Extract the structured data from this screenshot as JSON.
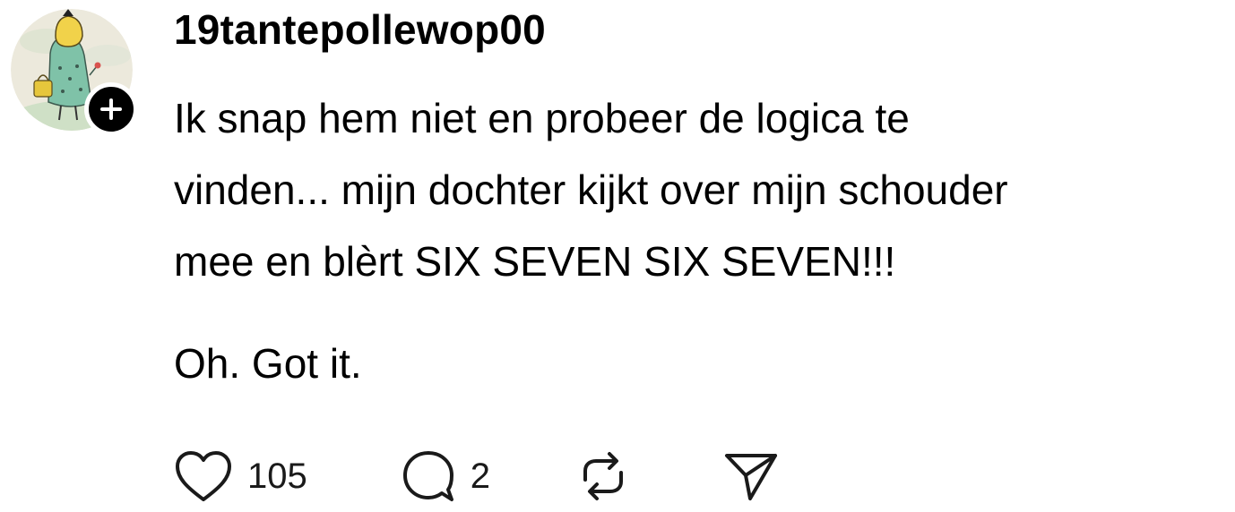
{
  "post": {
    "author": {
      "username": "19tantepollewop00",
      "avatar_icon": "avatar-illustration-icon",
      "follow_icon": "plus-icon"
    },
    "body": {
      "line1": "Ik snap hem niet en probeer de logica te",
      "line2": "vinden... mijn dochter kijkt over mijn schouder",
      "line3": "mee en blèrt SIX SEVEN SIX SEVEN!!!",
      "line4": "Oh. Got it."
    },
    "actions": {
      "like": {
        "icon": "heart-icon",
        "count": "105"
      },
      "reply": {
        "icon": "speech-bubble-icon",
        "count": "2"
      },
      "repost": {
        "icon": "repost-icon"
      },
      "share": {
        "icon": "send-icon"
      }
    },
    "colors": {
      "text": "#000000",
      "badge": "#000000",
      "background": "#ffffff"
    }
  }
}
